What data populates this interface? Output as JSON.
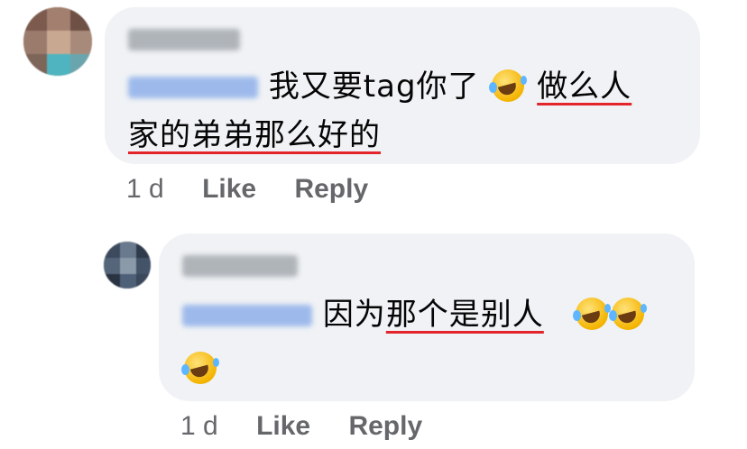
{
  "comments": [
    {
      "author": "Mei Ling",
      "tag": "CK Kong",
      "line1_text": "我又要tag你了",
      "line1_ul": "做么人",
      "line2_ul": "家的弟弟那么好的",
      "time": "1 d",
      "like": "Like",
      "reply": "Reply"
    },
    {
      "author": "CK Kong",
      "tag": "Mei Ling",
      "text": "因为",
      "text_ul": "那个是别人",
      "time": "1 d",
      "like": "Like",
      "reply": "Reply"
    }
  ],
  "emoji_name": "rolling-on-the-floor-laughing",
  "colors": {
    "bubble": "#f0f2f5",
    "underline": "#e3242b",
    "meta": "#65676b",
    "tag_blue": "#8fb0ea"
  }
}
